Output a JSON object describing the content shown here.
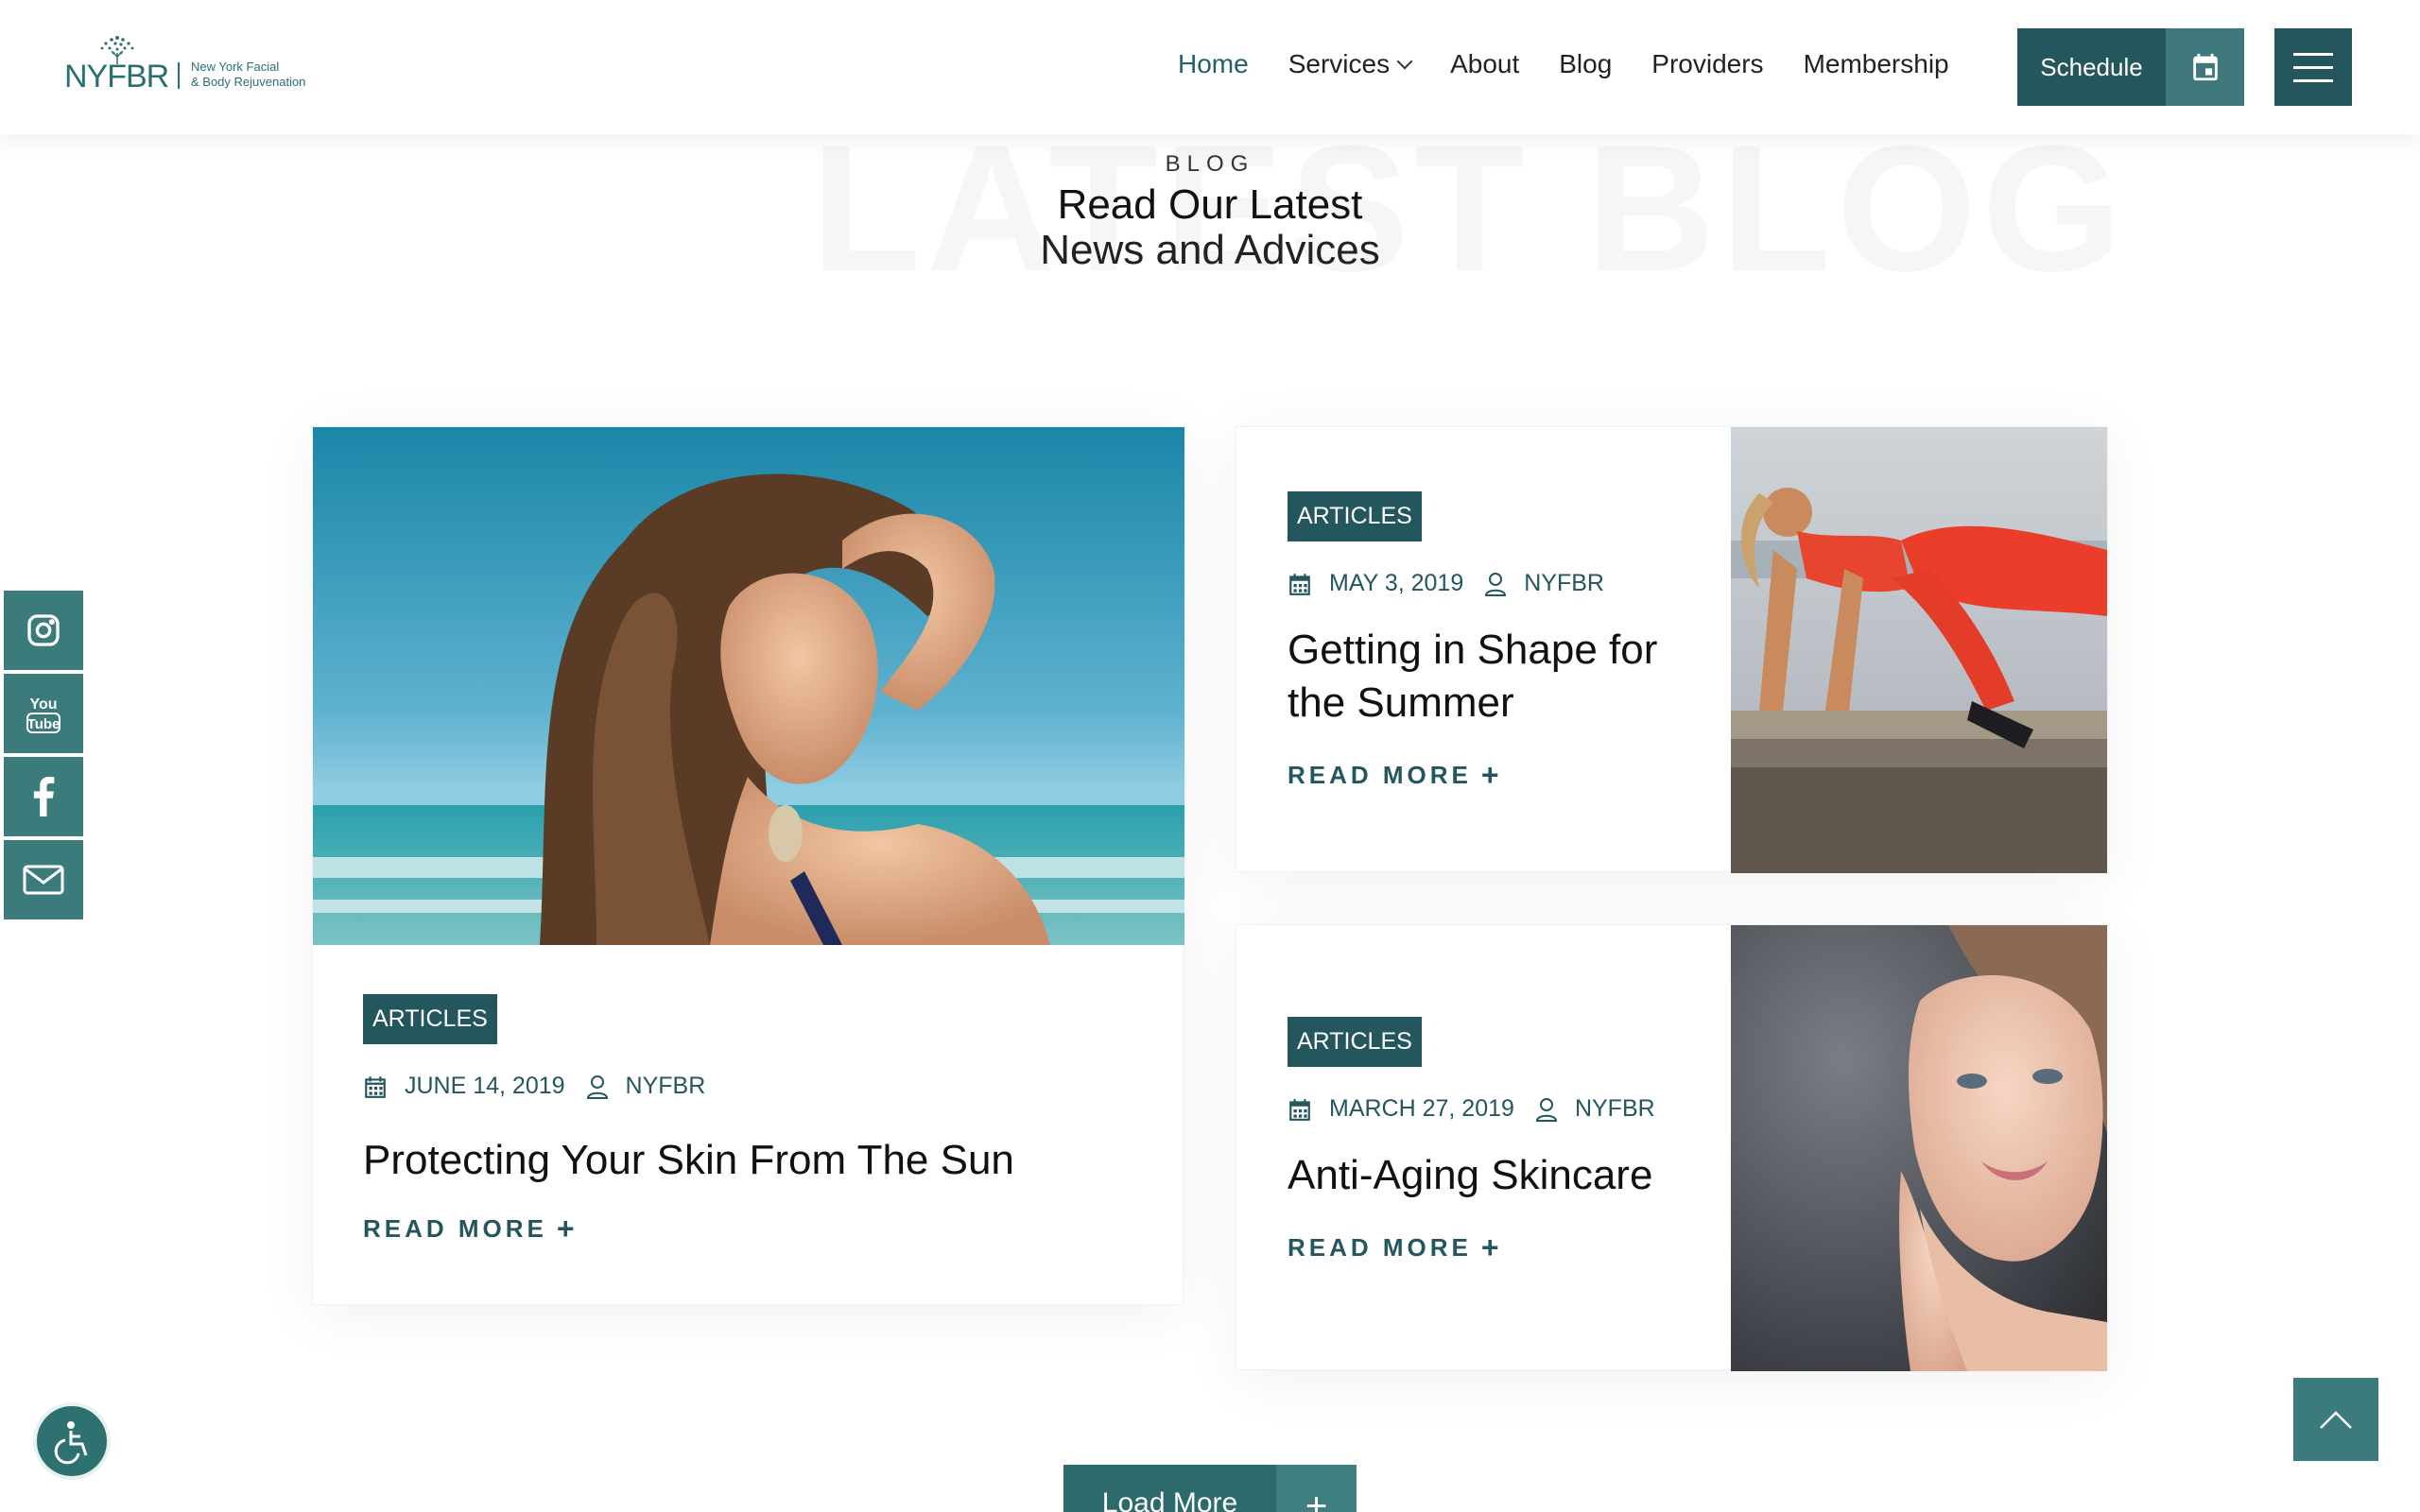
{
  "brand": {
    "logo_text": "NYFBR",
    "logo_sub_line1": "New York Facial",
    "logo_sub_line2": "& Body Rejuvenation"
  },
  "nav": {
    "items": [
      {
        "label": "Home",
        "active": true
      },
      {
        "label": "Services",
        "has_dropdown": true
      },
      {
        "label": "About"
      },
      {
        "label": "Blog"
      },
      {
        "label": "Providers"
      },
      {
        "label": "Membership"
      }
    ],
    "schedule_label": "Schedule"
  },
  "section": {
    "bg_word": "LATEST BLOG",
    "eyebrow": "BLOG",
    "heading_line1": "Read Our Latest",
    "heading_line2": "News and Advices"
  },
  "posts": [
    {
      "category": "ARTICLES",
      "date": "JUNE 14, 2019",
      "author": "NYFBR",
      "title": "Protecting Your Skin From The Sun",
      "read_more": "READ MORE"
    },
    {
      "category": "ARTICLES",
      "date": "MAY 3, 2019",
      "author": "NYFBR",
      "title_line1": "Getting in Shape for",
      "title_line2": "the Summer",
      "read_more": "READ MORE"
    },
    {
      "category": "ARTICLES",
      "date": "MARCH 27, 2019",
      "author": "NYFBR",
      "title": "Anti-Aging Skincare",
      "read_more": "READ MORE"
    }
  ],
  "social": [
    "instagram-icon",
    "youtube-icon",
    "facebook-icon",
    "email-icon"
  ],
  "load_more": {
    "label": "Load More",
    "plus": "+"
  },
  "colors": {
    "primary": "#23565d",
    "accent": "#3c7b7c",
    "nav_active": "#23606a"
  }
}
